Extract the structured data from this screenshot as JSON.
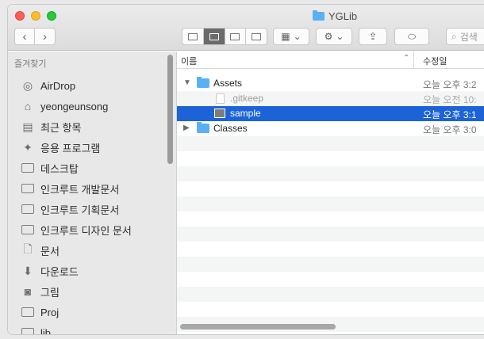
{
  "window": {
    "title": "YGLib"
  },
  "toolbar": {
    "back": "‹",
    "forward": "›",
    "search_placeholder": "검색"
  },
  "sidebar": {
    "section_title": "즐겨찾기",
    "items": [
      {
        "label": "AirDrop",
        "icon": "airdrop-icon"
      },
      {
        "label": "yeongeunsong",
        "icon": "home-icon"
      },
      {
        "label": "최근 항목",
        "icon": "recents-icon"
      },
      {
        "label": "응용 프로그램",
        "icon": "applications-icon"
      },
      {
        "label": "데스크탑",
        "icon": "desktop-icon"
      },
      {
        "label": "인크루트 개발문서",
        "icon": "folder-icon"
      },
      {
        "label": "인크루트 기획문서",
        "icon": "folder-icon"
      },
      {
        "label": "인크루트 디자인 문서",
        "icon": "folder-icon"
      },
      {
        "label": "문서",
        "icon": "documents-icon"
      },
      {
        "label": "다운로드",
        "icon": "downloads-icon"
      },
      {
        "label": "그림",
        "icon": "pictures-icon"
      },
      {
        "label": "Proj",
        "icon": "folder-icon"
      },
      {
        "label": "lib",
        "icon": "folder-icon"
      }
    ]
  },
  "columns": {
    "name": "이름",
    "date": "수정일"
  },
  "files": [
    {
      "name": "Assets",
      "date": "오늘 오후 3:2",
      "kind": "folder",
      "expanded": true
    },
    {
      "name": ".gitkeep",
      "date": "오늘 오전 10:",
      "kind": "file"
    },
    {
      "name": "sample",
      "date": "오늘 오후 3:1",
      "kind": "image",
      "selected": true
    },
    {
      "name": "Classes",
      "date": "오늘 오후 3:0",
      "kind": "folder",
      "expanded": false
    }
  ],
  "colors": {
    "selection": "#1c63d8",
    "folder": "#5ab0f4"
  }
}
